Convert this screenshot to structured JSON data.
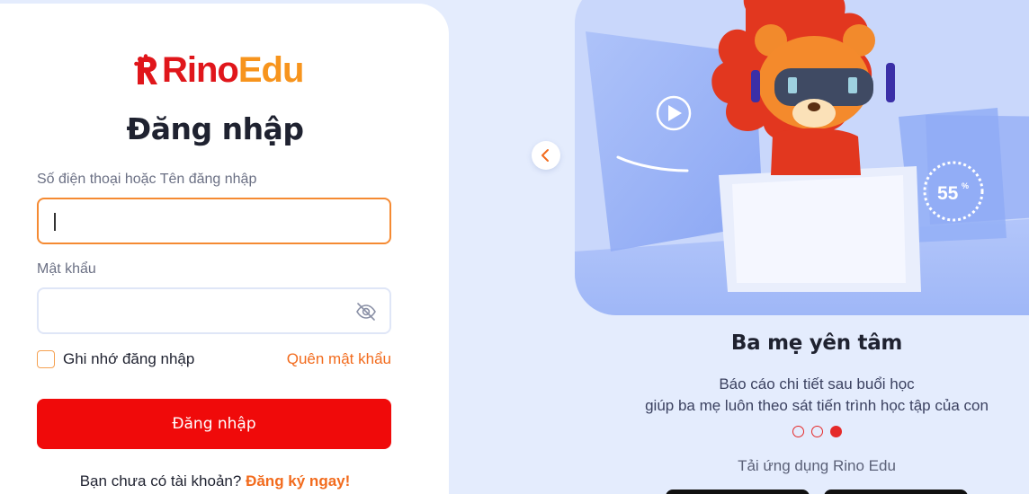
{
  "logo": {
    "part1": "Rino",
    "part2": "Edu"
  },
  "login": {
    "title": "Đăng nhập",
    "username_label": "Số điện thoại hoặc Tên đăng nhập",
    "username_value": "",
    "password_label": "Mật khẩu",
    "password_value": "",
    "remember_label": "Ghi nhớ đăng nhập",
    "forgot_label": "Quên mật khẩu",
    "submit_label": "Đăng nhập",
    "signup_prompt": "Bạn chưa có tài khoản?",
    "signup_link": "Đăng ký ngay!"
  },
  "promo": {
    "illustration_percent": "55",
    "illustration_percent_sign": "%",
    "title": "Ba mẹ yên tâm",
    "desc_line1": "Báo cáo chi tiết sau buổi học",
    "desc_line2": "giúp ba mẹ luôn theo sát tiến trình học tập của con",
    "slides": [
      {
        "active": false
      },
      {
        "active": false
      },
      {
        "active": true
      }
    ],
    "app_label": "Tải ứng dụng Rino Edu"
  },
  "colors": {
    "brand_red": "#e0161b",
    "brand_orange": "#f7941d",
    "button_red": "#f00a0a",
    "link_orange": "#f26b1d",
    "focus_border": "#f58a32",
    "background": "#e4ecfd"
  },
  "icons": [
    "rino-logo-icon",
    "eye-off-icon",
    "chevron-left-icon",
    "play-icon"
  ]
}
